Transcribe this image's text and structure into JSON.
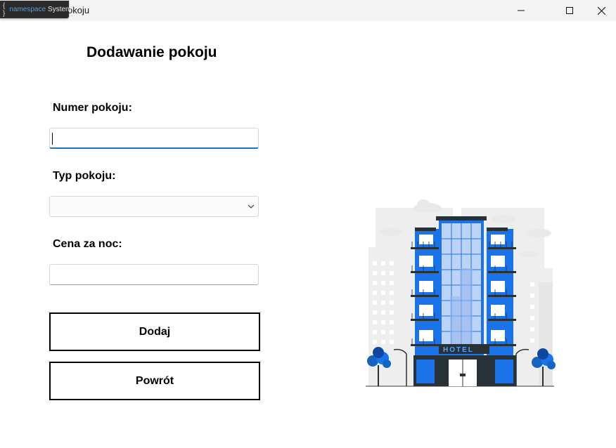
{
  "window": {
    "title": "Dodawanie pokoju",
    "title_visible_fragment": "okoju",
    "debug_badge": {
      "brace": "{ }",
      "keyword": "namespace",
      "name": "System"
    }
  },
  "form": {
    "heading": "Dodawanie pokoju",
    "room_number": {
      "label": "Numer pokoju:",
      "value": ""
    },
    "room_type": {
      "label": "Typ pokoju:",
      "selected": ""
    },
    "price": {
      "label": "Cena za noc:",
      "value": ""
    }
  },
  "buttons": {
    "add": "Dodaj",
    "back": "Powrót"
  },
  "illustration": {
    "sign_text": "HOTEL"
  },
  "colors": {
    "accent": "#1f6fbf",
    "building_blue": "#1a73e8",
    "background": "#ffffff"
  }
}
